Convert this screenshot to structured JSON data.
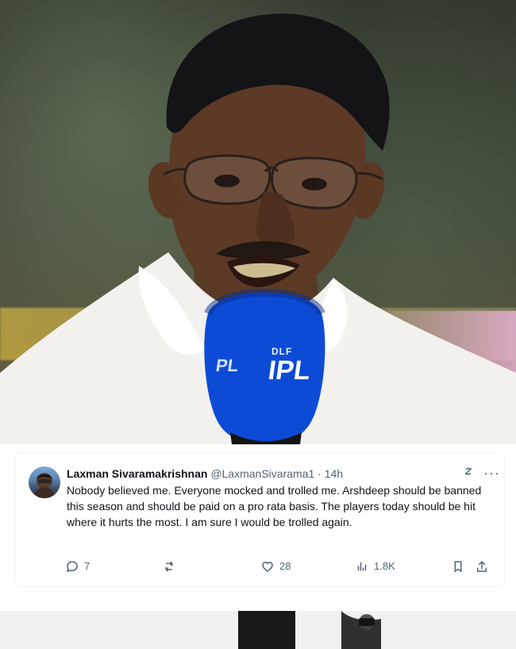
{
  "photo": {
    "mic_brand_line1": "DLF",
    "mic_brand_line2": "IPL",
    "mic_side_text": "PL"
  },
  "tweet": {
    "author_name": "Laxman Sivaramakrishnan",
    "author_handle": "@LaxmanSivarama1",
    "separator": " · ",
    "time": "14h",
    "text": "Nobody believed me. Everyone mocked and trolled me. Arshdeep should be banned this season and should be paid on a pro rata basis. The players today should be hit where it hurts the most. I am sure I would be trolled again.",
    "actions": {
      "reply_count": "7",
      "repost_count": "",
      "like_count": "28",
      "views_count": "1.8K"
    },
    "icons": {
      "grok": "grok-icon",
      "more": "more-icon",
      "reply": "reply-icon",
      "repost": "repost-icon",
      "like": "like-icon",
      "views": "views-icon",
      "bookmark": "bookmark-icon",
      "share": "share-icon"
    },
    "more_glyph": "···"
  },
  "colors": {
    "text_primary": "#0f1419",
    "text_secondary": "#536471",
    "mic_blue": "#0d4bd7"
  }
}
